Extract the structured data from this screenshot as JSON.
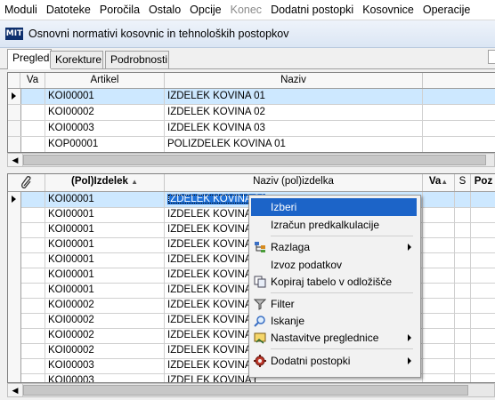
{
  "menu": [
    "Moduli",
    "Datoteke",
    "Poročila",
    "Ostalo",
    "Opcije",
    "Konec",
    "Dodatni postopki",
    "Kosovnice",
    "Operacije"
  ],
  "window": {
    "logo_text": "MIT",
    "title": "Osnovni normativi kosovnic in tehnoloških postopkov"
  },
  "tabs": [
    "Pregled",
    "Korekture",
    "Podrobnosti"
  ],
  "top_grid": {
    "headers": [
      "Va",
      "Artikel",
      "Naziv"
    ],
    "rows": [
      {
        "artikel": "KOI00001",
        "naziv": "IZDELEK KOVINA 01"
      },
      {
        "artikel": "KOI00002",
        "naziv": "IZDELEK KOVINA 02"
      },
      {
        "artikel": "KOI00003",
        "naziv": "IZDELEK KOVINA 03"
      },
      {
        "artikel": "KOP00001",
        "naziv": "POLIZDELEK KOVINA 01"
      }
    ]
  },
  "bottom_grid": {
    "headers": {
      "izdelek": "(Pol)Izdelek",
      "naziv": "Naziv (pol)izdelka",
      "va": "Va",
      "s": "S",
      "poz": "Poz"
    },
    "rows": [
      {
        "izdelek": "KOI00001",
        "naziv": "IZDELEK KOVINA 01"
      },
      {
        "izdelek": "KOI00001",
        "naziv": "IZDELEK KOVINA ("
      },
      {
        "izdelek": "KOI00001",
        "naziv": "IZDELEK KOVINA ("
      },
      {
        "izdelek": "KOI00001",
        "naziv": "IZDELEK KOVINA ("
      },
      {
        "izdelek": "KOI00001",
        "naziv": "IZDELEK KOVINA ("
      },
      {
        "izdelek": "KOI00001",
        "naziv": "IZDELEK KOVINA ("
      },
      {
        "izdelek": "KOI00001",
        "naziv": "IZDELEK KOVINA ("
      },
      {
        "izdelek": "KOI00002",
        "naziv": "IZDELEK KOVINA ("
      },
      {
        "izdelek": "KOI00002",
        "naziv": "IZDELEK KOVINA ("
      },
      {
        "izdelek": "KOI00002",
        "naziv": "IZDELEK KOVINA ("
      },
      {
        "izdelek": "KOI00002",
        "naziv": "IZDELEK KOVINA ("
      },
      {
        "izdelek": "KOI00003",
        "naziv": "IZDELEK KOVINA ("
      },
      {
        "izdelek": "KOI00003",
        "naziv": "IZDELEK KOVINA ("
      }
    ]
  },
  "context_menu": [
    {
      "label": "Izberi",
      "icon": ""
    },
    {
      "label": "Izračun predkalkulacije",
      "icon": ""
    },
    {
      "label": "Razlaga",
      "icon": "tree-icon",
      "submenu": true
    },
    {
      "label": "Izvoz podatkov",
      "icon": ""
    },
    {
      "label": "Kopiraj tabelo v odložišče",
      "icon": "copy-icon"
    },
    {
      "label": "Filter",
      "icon": "filter-icon"
    },
    {
      "label": "Iskanje",
      "icon": "search-icon"
    },
    {
      "label": "Nastavitve preglednice",
      "icon": "settings-icon",
      "submenu": true
    },
    {
      "label": "Dodatni postopki",
      "icon": "gear-icon",
      "submenu": true
    }
  ]
}
